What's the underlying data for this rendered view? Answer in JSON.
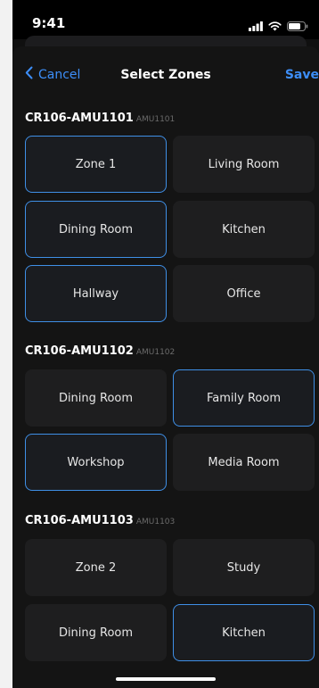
{
  "status": {
    "time": "9:41"
  },
  "nav": {
    "cancel": "Cancel",
    "title": "Select Zones",
    "save": "Save"
  },
  "colors": {
    "accent": "#3d8ef7",
    "tile_bg": "#1e1e1f",
    "selected_border": "#3f8fe6"
  },
  "groups": [
    {
      "name": "CR106-AMU1101",
      "code": "AMU1101",
      "zones": [
        {
          "label": "Zone 1",
          "selected": true
        },
        {
          "label": "Living Room",
          "selected": false
        },
        {
          "label": "Dining Room",
          "selected": true
        },
        {
          "label": "Kitchen",
          "selected": false
        },
        {
          "label": "Hallway",
          "selected": true
        },
        {
          "label": "Office",
          "selected": false
        }
      ]
    },
    {
      "name": "CR106-AMU1102",
      "code": "AMU1102",
      "zones": [
        {
          "label": "Dining Room",
          "selected": false
        },
        {
          "label": "Family Room",
          "selected": true
        },
        {
          "label": "Workshop",
          "selected": true
        },
        {
          "label": "Media Room",
          "selected": false
        }
      ]
    },
    {
      "name": "CR106-AMU1103",
      "code": "AMU1103",
      "zones": [
        {
          "label": "Zone 2",
          "selected": false
        },
        {
          "label": "Study",
          "selected": false
        },
        {
          "label": "Dining Room",
          "selected": false
        },
        {
          "label": "Kitchen",
          "selected": true
        }
      ]
    }
  ]
}
